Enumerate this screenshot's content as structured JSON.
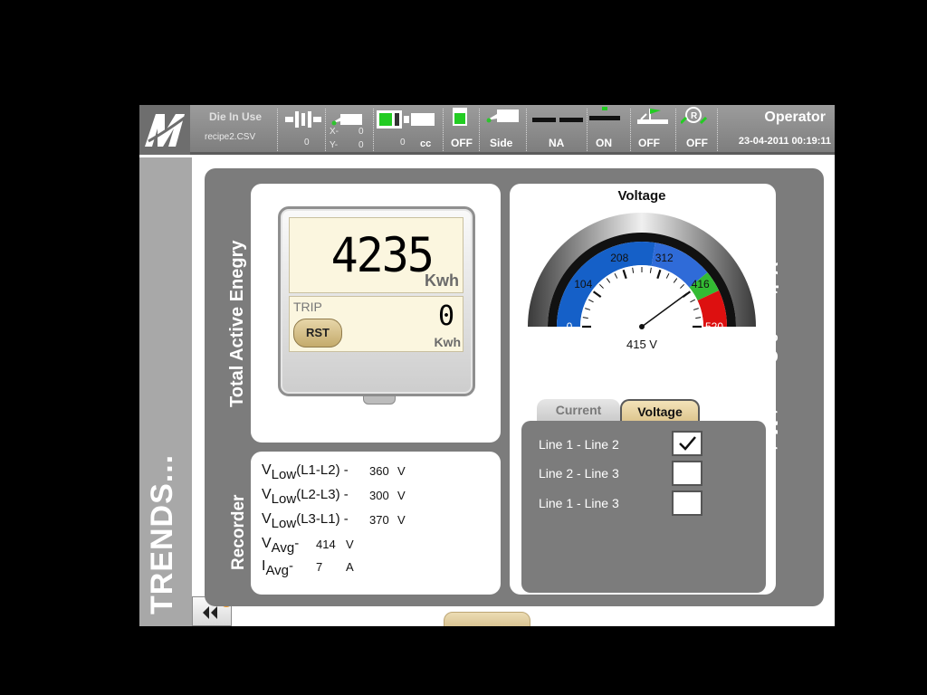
{
  "header": {
    "die_in_use_label": "Die In Use",
    "recipe_file": "recipe2.CSV",
    "die_value": "0",
    "x_label": "X-",
    "y_label": "Y-",
    "x_value": "0",
    "y_value": "0",
    "cc_value": "0",
    "cc_unit": "cc",
    "status_1": "OFF",
    "status_2": "Side",
    "status_3": "NA",
    "status_4": "ON",
    "status_5": "OFF",
    "status_6": "OFF",
    "user_role": "Operator",
    "datetime": "23-04-2011 00:19:11"
  },
  "sidebar": {
    "title": "TRENDS..."
  },
  "energy": {
    "section_label": "Total Active Enegry",
    "value": "4235",
    "unit": "Kwh",
    "trip_label": "TRIP",
    "trip_value": "0",
    "trip_unit": "Kwh",
    "reset_label": "RST"
  },
  "recorder": {
    "section_label": "Recorder",
    "rows": [
      {
        "symbol": "V",
        "sub": "Low",
        "param": "(L1-L2) -",
        "value": "360",
        "unit": "V"
      },
      {
        "symbol": "V",
        "sub": "Low",
        "param": "(L2-L3) -",
        "value": "300",
        "unit": "V"
      },
      {
        "symbol": "V",
        "sub": "Low",
        "param": "(L3-L1) -",
        "value": "370",
        "unit": "V"
      },
      {
        "symbol": "V",
        "sub": "Avg",
        "param": "-",
        "value": "414",
        "unit": "V"
      },
      {
        "symbol": "I",
        "sub": "Avg",
        "param": "-",
        "value": "7",
        "unit": "A"
      }
    ]
  },
  "meter": {
    "section_label": "Voltage & Current Meter",
    "gauge": {
      "title": "Voltage",
      "min": 0,
      "max": 520,
      "value": 415,
      "readout": "415  V",
      "tick_labels": [
        "0",
        "104",
        "208",
        "312",
        "416",
        "520"
      ],
      "bands": [
        {
          "from": 0,
          "to": 0.55,
          "color": "#1560c8"
        },
        {
          "from": 0.55,
          "to": 0.78,
          "color": "#2f6bd8"
        },
        {
          "from": 0.78,
          "to": 0.86,
          "color": "#33bb33"
        },
        {
          "from": 0.86,
          "to": 1.0,
          "color": "#dd1010"
        }
      ]
    },
    "tabs": [
      "Current",
      "Voltage"
    ],
    "active_tab": "Voltage",
    "lines": [
      {
        "label": "Line 1 - Line 2",
        "checked": true
      },
      {
        "label": "Line 2 - Line 3",
        "checked": false
      },
      {
        "label": "Line 1 - Line 3",
        "checked": false
      }
    ]
  }
}
